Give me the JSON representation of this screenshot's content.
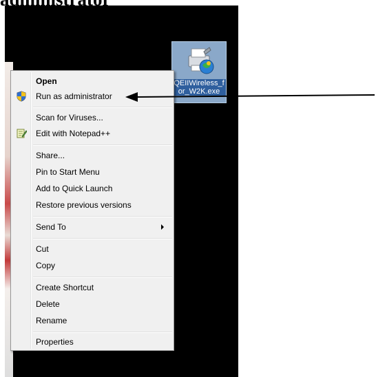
{
  "heading": "administrator",
  "desktop_icon": {
    "label": "QEIIWireless_for_W2K.exe",
    "icon": "setup-printer-icon"
  },
  "menu": {
    "items": [
      {
        "label": "Open",
        "bold": true,
        "icon": null
      },
      {
        "label": "Run as administrator",
        "icon": "uac-shield-icon"
      },
      {
        "label": "Scan for Viruses...",
        "icon": null
      },
      {
        "label": "Edit with Notepad++",
        "icon": "notepad-icon"
      },
      {
        "label": "Share...",
        "icon": null
      },
      {
        "label": "Pin to Start Menu",
        "icon": null
      },
      {
        "label": "Add to Quick Launch",
        "icon": null
      },
      {
        "label": "Restore previous versions",
        "icon": null
      },
      {
        "label": "Send To",
        "icon": null,
        "submenu": true
      },
      {
        "label": "Cut",
        "icon": null
      },
      {
        "label": "Copy",
        "icon": null
      },
      {
        "label": "Create Shortcut",
        "icon": null
      },
      {
        "label": "Delete",
        "icon": null
      },
      {
        "label": "Rename",
        "icon": null
      },
      {
        "label": "Properties",
        "icon": null
      }
    ]
  },
  "annotation": {
    "icon": "pointer-arrow-icon",
    "points_to": "Run as administrator"
  }
}
